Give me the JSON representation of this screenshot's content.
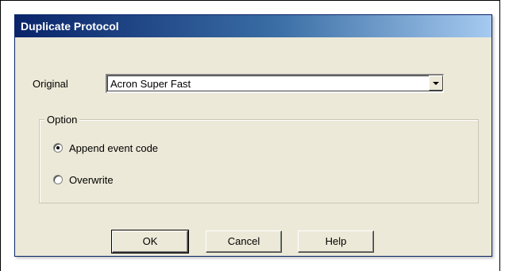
{
  "dialog": {
    "title": "Duplicate Protocol",
    "original_label": "Original",
    "original_value": "Acron Super Fast",
    "option_group_label": "Option",
    "options": [
      {
        "label": "Append event code",
        "checked": true
      },
      {
        "label": "Overwrite",
        "checked": false
      }
    ],
    "buttons": {
      "ok": "OK",
      "cancel": "Cancel",
      "help": "Help"
    }
  },
  "icons": {
    "dropdown": "chevron-down-icon"
  },
  "colors": {
    "titlebar": "#0a246a",
    "titlebar_gradient_end": "#a6caf0",
    "dialog_background": "#ece9d8"
  }
}
